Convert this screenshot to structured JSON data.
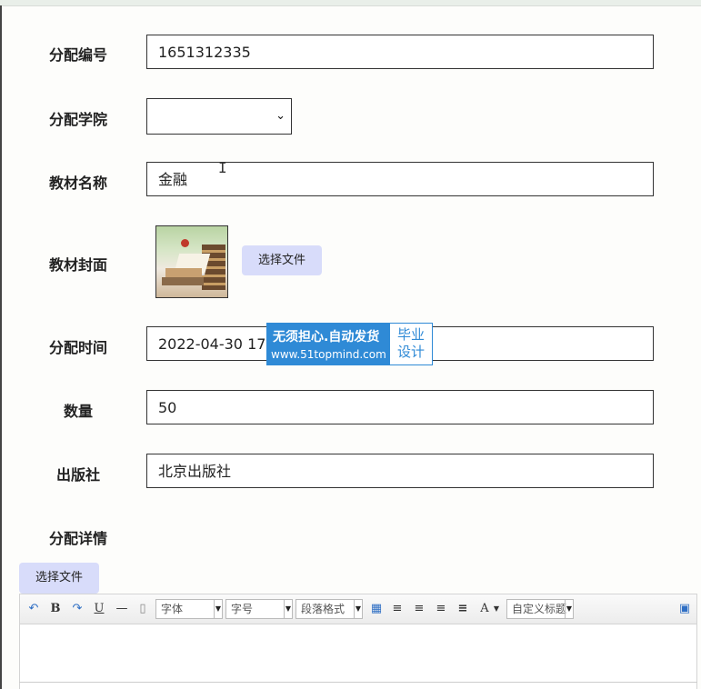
{
  "form": {
    "assign_no": {
      "label": "分配编号",
      "value": "1651312335"
    },
    "college": {
      "label": "分配学院",
      "value": ""
    },
    "textbook_name": {
      "label": "教材名称",
      "value": "金融"
    },
    "cover": {
      "label": "教材封面",
      "button": "选择文件"
    },
    "assign_time": {
      "label": "分配时间",
      "value": "2022-04-30 17:5"
    },
    "quantity": {
      "label": "数量",
      "value": "50"
    },
    "publisher": {
      "label": "出版社",
      "value": "北京出版社"
    },
    "details": {
      "label": "分配详情",
      "button": "选择文件"
    }
  },
  "watermark": {
    "line1": "无须担心.自动发货",
    "line2": "www.51topmind.com",
    "right_line1": "毕业",
    "right_line2": "设计"
  },
  "editor_toolbar": {
    "bold": "B",
    "underline": "U",
    "font_family": "字体",
    "font_size": "字号",
    "paragraph": "段落格式",
    "font_color": "A",
    "custom_title": "自定义标题"
  },
  "colors": {
    "file_button": "#d8dcfa",
    "watermark_blue": "#2f8ad6"
  }
}
